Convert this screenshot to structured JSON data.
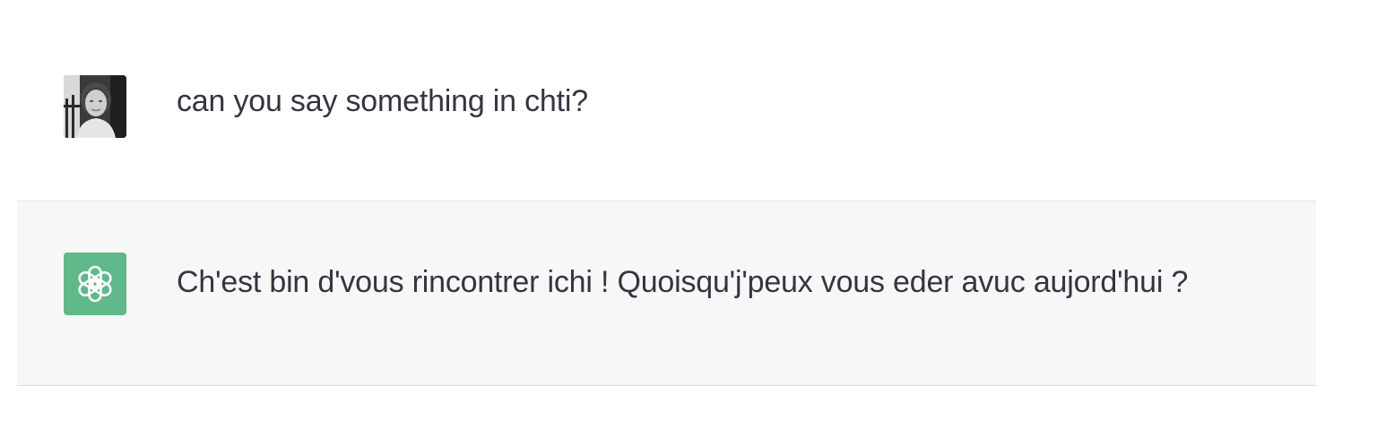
{
  "conversation": {
    "messages": [
      {
        "role": "user",
        "avatar_icon": "user-photo-avatar",
        "text": "can you say something in chti?"
      },
      {
        "role": "assistant",
        "avatar_icon": "openai-logo-icon",
        "avatar_color": "#5fb988",
        "text": "Ch'est bin d'vous rincontrer ichi ! Quoisqu'j'peux vous eder avuc aujord'hui ?"
      }
    ]
  }
}
